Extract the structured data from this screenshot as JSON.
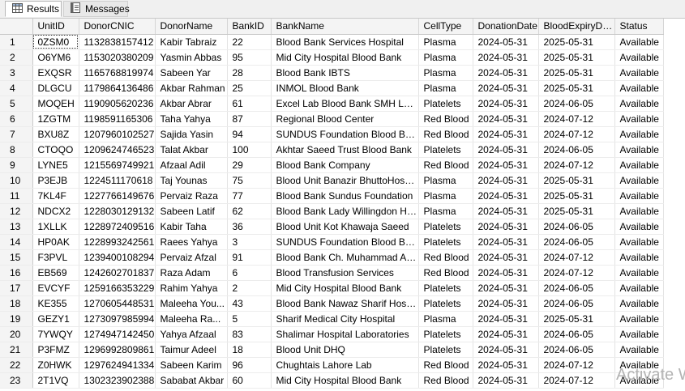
{
  "tabs": [
    {
      "label": "Results",
      "icon": "grid-icon"
    },
    {
      "label": "Messages",
      "icon": "messages-icon"
    }
  ],
  "columns": [
    "UnitID",
    "DonorCNIC",
    "DonorName",
    "BankID",
    "BankName",
    "CellType",
    "DonationDate",
    "BloodExpiryDate",
    "Status"
  ],
  "rows": [
    [
      "1",
      "0ZSM0",
      "1132838157412",
      "Kabir  Tabraiz",
      "22",
      "Blood Bank Services Hospital",
      "Plasma",
      "2024-05-31",
      "2025-05-31",
      "Available"
    ],
    [
      "2",
      "O6YM6",
      "1153020380209",
      "Yasmin Abbas",
      "95",
      "Mid City Hospital Blood Bank",
      "Plasma",
      "2024-05-31",
      "2025-05-31",
      "Available"
    ],
    [
      "3",
      "EXQSR",
      "1165768819974",
      "Sabeen  Yar",
      "28",
      "Blood Bank IBTS",
      "Plasma",
      "2024-05-31",
      "2025-05-31",
      "Available"
    ],
    [
      "4",
      "DLGCU",
      "1179864136486",
      "Akbar  Rahman",
      "25",
      "INMOL Blood Bank",
      "Plasma",
      "2024-05-31",
      "2025-05-31",
      "Available"
    ],
    [
      "5",
      "MOQEH",
      "1190905620236",
      "Akbar  Abrar",
      "61",
      "Excel Lab Blood Bank SMH Lahore",
      "Platelets",
      "2024-05-31",
      "2024-06-05",
      "Available"
    ],
    [
      "6",
      "1ZGTM",
      "1198591165306",
      "Taha  Yahya",
      "87",
      "Regional Blood Center",
      "Red Blood",
      "2024-05-31",
      "2024-07-12",
      "Available"
    ],
    [
      "7",
      "BXU8Z",
      "1207960102527",
      "Sajida  Yasin",
      "94",
      "SUNDUS Foundation Blood Bank",
      "Red Blood",
      "2024-05-31",
      "2024-07-12",
      "Available"
    ],
    [
      "8",
      "CTOQO",
      "1209624746523",
      "Talat  Akbar",
      "100",
      "Akhtar Saeed Trust Blood Bank",
      "Platelets",
      "2024-05-31",
      "2024-06-05",
      "Available"
    ],
    [
      "9",
      "LYNE5",
      "1215569749921",
      "Afzaal  Adil",
      "29",
      "Blood Bank Company",
      "Red Blood",
      "2024-05-31",
      "2024-07-12",
      "Available"
    ],
    [
      "10",
      "P3EJB",
      "1224511170618",
      "Taj  Younas",
      "75",
      "Blood Unit Banazir BhuttoHospital",
      "Plasma",
      "2024-05-31",
      "2025-05-31",
      "Available"
    ],
    [
      "11",
      "7KL4F",
      "1227766149676",
      "Pervaiz Raza",
      "77",
      "Blood Bank Sundus Foundation",
      "Plasma",
      "2024-05-31",
      "2025-05-31",
      "Available"
    ],
    [
      "12",
      "NDCX2",
      "1228030129132",
      "Sabeen  Latif",
      "62",
      "Blood Bank Lady Willingdon Hos...",
      "Plasma",
      "2024-05-31",
      "2025-05-31",
      "Available"
    ],
    [
      "13",
      "1XLLK",
      "1228972409516",
      "Kabir  Taha",
      "36",
      "Blood Unit Kot Khawaja Saeed",
      "Platelets",
      "2024-05-31",
      "2024-06-05",
      "Available"
    ],
    [
      "14",
      "HP0AK",
      "1228993242561",
      "Raees  Yahya",
      "3",
      "SUNDUS Foundation Blood Bank",
      "Platelets",
      "2024-05-31",
      "2024-06-05",
      "Available"
    ],
    [
      "15",
      "F3PVL",
      "1239400108294",
      "Pervaiz Afzal",
      "91",
      "Blood Bank Ch. Muhammad Akra...",
      "Red Blood",
      "2024-05-31",
      "2024-07-12",
      "Available"
    ],
    [
      "16",
      "EB569",
      "1242602701837",
      "Raza  Adam",
      "6",
      "Blood Transfusion Services",
      "Red Blood",
      "2024-05-31",
      "2024-07-12",
      "Available"
    ],
    [
      "17",
      "EVCYF",
      "1259166353229",
      "Rahim  Yahya",
      "2",
      "Mid City Hospital Blood Bank",
      "Platelets",
      "2024-05-31",
      "2024-06-05",
      "Available"
    ],
    [
      "18",
      "KE355",
      "1270605448531",
      "Maleeha  You...",
      "43",
      "Blood Bank Nawaz Sharif Hospital",
      "Platelets",
      "2024-05-31",
      "2024-06-05",
      "Available"
    ],
    [
      "19",
      "GEZY1",
      "1273097985994",
      "Maleeha  Ra...",
      "5",
      "Sharif Medical City Hospital",
      "Plasma",
      "2024-05-31",
      "2025-05-31",
      "Available"
    ],
    [
      "20",
      "7YWQY",
      "1274947142450",
      "Yahya  Afzaal",
      "83",
      "Shalimar Hospital Laboratories",
      "Platelets",
      "2024-05-31",
      "2024-06-05",
      "Available"
    ],
    [
      "21",
      "P3FMZ",
      "1296992809861",
      "Taimur  Adeel",
      "18",
      "Blood Unit DHQ",
      "Platelets",
      "2024-05-31",
      "2024-06-05",
      "Available"
    ],
    [
      "22",
      "Z0HWK",
      "1297624941334",
      "Sabeen  Karim",
      "96",
      "Chughtais Lahore Lab",
      "Red Blood",
      "2024-05-31",
      "2024-07-12",
      "Available"
    ],
    [
      "23",
      "2T1VQ",
      "1302323902388",
      "Sababat  Akbar",
      "60",
      "Mid City Hospital Blood Bank",
      "Red Blood",
      "2024-05-31",
      "2024-07-12",
      "Available"
    ]
  ],
  "watermark": "Activate W"
}
